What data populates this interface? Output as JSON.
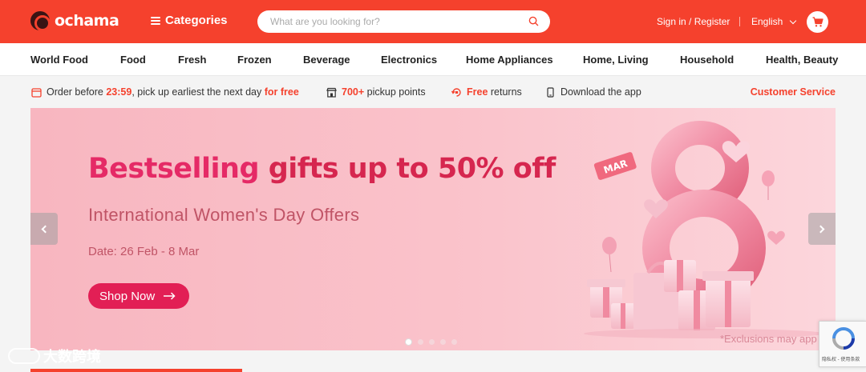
{
  "header": {
    "logo_text": "ochama",
    "categories_label": "Categories",
    "search_placeholder": "What are you looking for?",
    "signin_label": "Sign in / Register",
    "language_label": "English",
    "brand_color": "#f5412d"
  },
  "nav": {
    "items": [
      "World Food",
      "Food",
      "Fresh",
      "Frozen",
      "Beverage",
      "Electronics",
      "Home Appliances",
      "Home, Living",
      "Household",
      "Health, Beauty"
    ]
  },
  "info_bar": {
    "order": {
      "pre": "Order before",
      "time": "23:59",
      "mid": ", pick up earliest the next day",
      "free": "for free"
    },
    "pickup": {
      "count": "700+",
      "text": "pickup points"
    },
    "returns": {
      "free": "Free",
      "text": "returns"
    },
    "download": "Download the app",
    "customer_service": "Customer Service"
  },
  "banner": {
    "title_part1": "Bestselling",
    "title_part2": "gifts up to 50% off",
    "subtitle": "International Women's Day Offers",
    "date": "Date: 26 Feb - 8 Mar",
    "button": "Shop Now",
    "exclusions": "*Exclusions may app",
    "tag": "MAR",
    "active_slide": 1,
    "slide_count": 5
  },
  "watermark": {
    "text": "大数跨境"
  },
  "recaptcha": {
    "text": "隐私权 - 使用条款"
  }
}
